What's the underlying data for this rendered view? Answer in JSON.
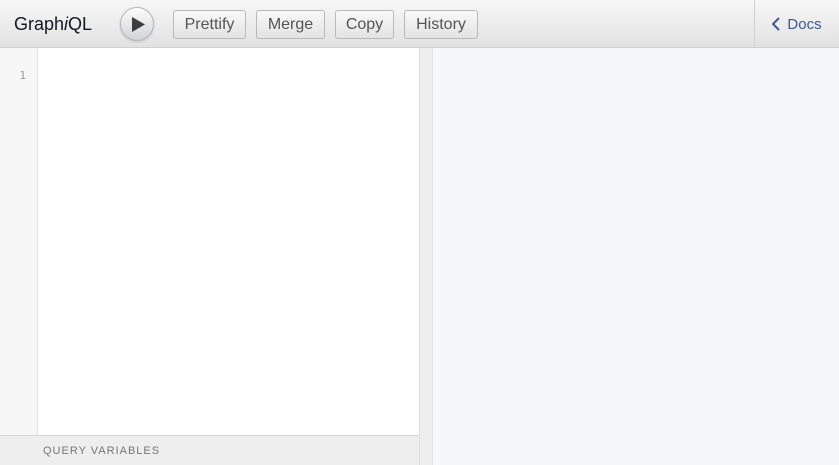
{
  "app": {
    "title_prefix": "Graph",
    "title_italic": "i",
    "title_suffix": "QL"
  },
  "toolbar": {
    "execute_icon": "play-icon",
    "prettify_label": "Prettify",
    "merge_label": "Merge",
    "copy_label": "Copy",
    "history_label": "History",
    "docs_label": "Docs",
    "docs_icon": "chevron-left-icon"
  },
  "editor": {
    "line_numbers": [
      "1"
    ],
    "query_text": ""
  },
  "variables": {
    "title": "QUERY VARIABLES"
  },
  "colors": {
    "docs_link": "#3b5998",
    "topbar_top": "#f7f7f7",
    "topbar_bottom": "#e2e2e2",
    "result_bg": "#f6f7f8"
  }
}
